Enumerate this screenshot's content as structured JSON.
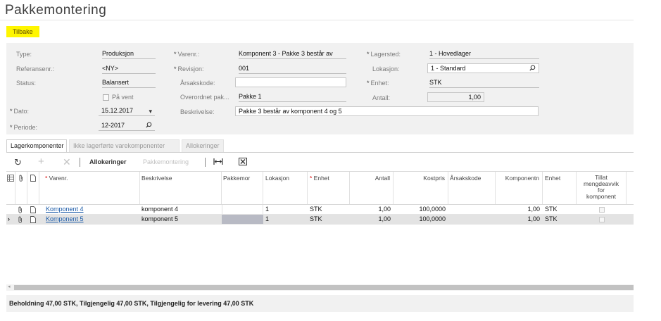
{
  "page": {
    "title": "Pakkemontering"
  },
  "back_label": "Tilbake",
  "form": {
    "type": {
      "label": "Type:",
      "value": "Produksjon"
    },
    "refnr": {
      "label": "Referansenr.:",
      "value": "<NY>"
    },
    "status": {
      "label": "Status:",
      "value": "Balansert"
    },
    "on_hold": {
      "label": "På vent"
    },
    "date": {
      "label": "Dato:",
      "value": "15.12.2017"
    },
    "period": {
      "label": "Periode:",
      "value": "12-2017"
    },
    "item": {
      "label": "Varenr.:",
      "value": "Komponent 3 - Pakke 3 består av"
    },
    "revision": {
      "label": "Revisjon:",
      "value": "001"
    },
    "reason": {
      "label": "Årsakskode:",
      "value": ""
    },
    "parent": {
      "label": "Overordnet pak...",
      "value": "Pakke 1"
    },
    "description": {
      "label": "Beskrivelse:",
      "value": "Pakke 3 består av komponent 4 og 5"
    },
    "warehouse": {
      "label": "Lagersted:",
      "value": "1 - Hovedlager"
    },
    "location": {
      "label": "Lokasjon:",
      "value": "1 - Standard"
    },
    "unit": {
      "label": "Enhet:",
      "value": "STK"
    },
    "quantity": {
      "label": "Antall:",
      "value": "1,00"
    }
  },
  "tabs": [
    "Lagerkomponenter",
    "Ikke lagerførte varekomponenter",
    "Allokeringer"
  ],
  "toolbar": {
    "allocations": "Allokeringer",
    "packing": "Pakkemontering"
  },
  "grid": {
    "headers": {
      "item": "Varenr.",
      "description": "Beskrivelse",
      "parent": "Pakkemor",
      "location": "Lokasjon",
      "unit": "Enhet",
      "qty": "Antall",
      "cost": "Kostpris",
      "reason": "Årsakskode",
      "component": "Komponentn",
      "unit2": "Enhet",
      "allow": "Tillat mengdeavvik for komponent"
    },
    "rows": [
      {
        "item": "Komponent 4",
        "description": "komponent 4",
        "parent": "",
        "location": "1",
        "unit": "STK",
        "qty": "1,00",
        "cost": "100,0000",
        "reason": "",
        "component": "1,00",
        "unit2": "STK"
      },
      {
        "item": "Komponent 5",
        "description": "komponent 5",
        "parent": "",
        "location": "1",
        "unit": "STK",
        "qty": "1,00",
        "cost": "100,0000",
        "reason": "",
        "component": "1,00",
        "unit2": "STK"
      }
    ]
  },
  "footer": "Beholdning 47,00 STK, Tilgjengelig 47,00 STK, Tilgjengelig for levering 47,00 STK",
  "colors": {
    "highlight": "#fff600",
    "link": "#1a5aa8",
    "panel": "#f1f1f1"
  }
}
